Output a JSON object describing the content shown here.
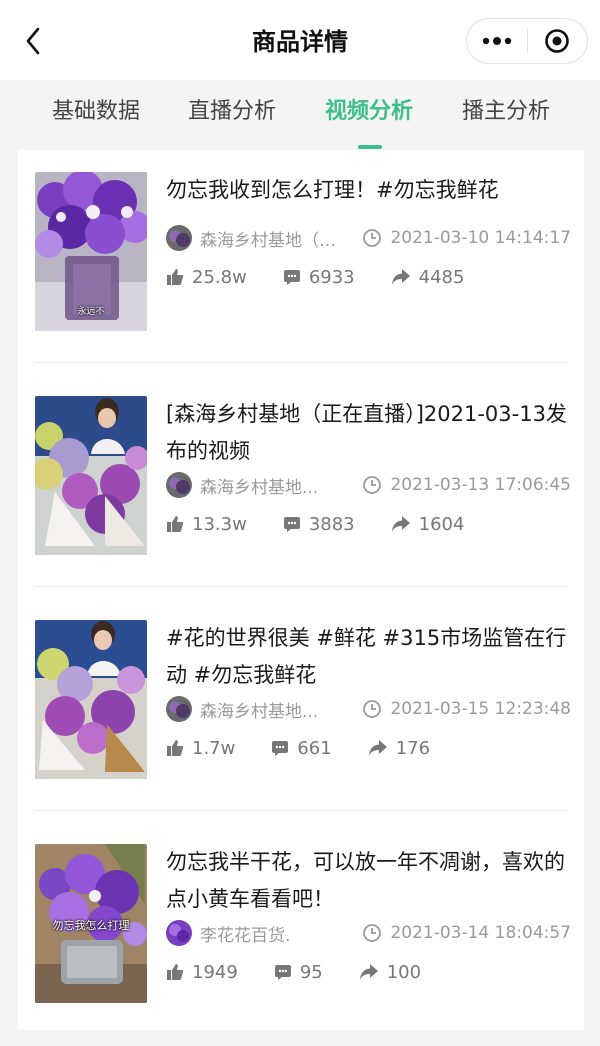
{
  "nav": {
    "title": "商品详情",
    "back_icon": "chevron-left-icon",
    "more_icon": "more-dots-icon",
    "close_icon": "target-circle-icon"
  },
  "tabs": [
    {
      "label": "基础数据",
      "active": false
    },
    {
      "label": "直播分析",
      "active": false
    },
    {
      "label": "视频分析",
      "active": true
    },
    {
      "label": "播主分析",
      "active": false
    }
  ],
  "colors": {
    "accent": "#3dbf8c",
    "text": "#1a1a1a",
    "muted": "#9a9a9a"
  },
  "videos": [
    {
      "title": "勿忘我收到怎么打理！#勿忘我鲜花",
      "thumb_caption": "永远不",
      "author": "森海乡村基地（…",
      "time": "2021-03-10 14:14:17",
      "likes": "25.8w",
      "comments": "6933",
      "shares": "4485"
    },
    {
      "title": "[森海乡村基地（正在直播）]2021-03-13发布的视频",
      "thumb_caption": "",
      "author": "森海乡村基地...",
      "time": "2021-03-13 17:06:45",
      "likes": "13.3w",
      "comments": "3883",
      "shares": "1604"
    },
    {
      "title": "#花的世界很美 #鲜花 #315市场监管在行动 #勿忘我鲜花",
      "thumb_caption": "",
      "author": "森海乡村基地...",
      "time": "2021-03-15 12:23:48",
      "likes": "1.7w",
      "comments": "661",
      "shares": "176"
    },
    {
      "title": "勿忘我半干花，可以放一年不凋谢，喜欢的点小黄车看看吧！",
      "thumb_caption": "勿忘我怎么打理",
      "author": "李花花百货.",
      "time": "2021-03-14 18:04:57",
      "likes": "1949",
      "comments": "95",
      "shares": "100"
    }
  ]
}
